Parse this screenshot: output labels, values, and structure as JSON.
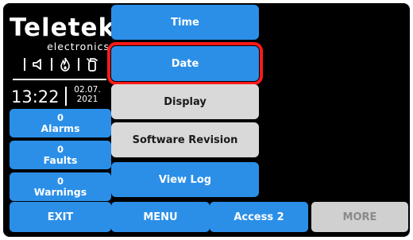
{
  "logo": {
    "brand": "Teletek",
    "sub": "electronics"
  },
  "status_icons": [
    "speaker-icon",
    "fire-icon",
    "extinguisher-icon"
  ],
  "clock": {
    "time": "13:22",
    "date_day_month": "02.07.",
    "date_year": "2021"
  },
  "status": [
    {
      "count": "0",
      "label": "Alarms"
    },
    {
      "count": "0",
      "label": "Faults"
    },
    {
      "count": "0",
      "label": "Warnings"
    }
  ],
  "menu": [
    {
      "label": "Time",
      "style": "blue",
      "selected": false
    },
    {
      "label": "Date",
      "style": "blue",
      "selected": true
    },
    {
      "label": "Display",
      "style": "gray",
      "selected": false
    },
    {
      "label": "Software Revision",
      "style": "gray",
      "selected": false
    },
    {
      "label": "View Log",
      "style": "blue",
      "selected": false
    }
  ],
  "bottom": {
    "exit": "EXIT",
    "menu": "MENU",
    "access": "Access 2",
    "more": "MORE"
  },
  "colors": {
    "accent": "#2b8fe8",
    "selection": "#ff1a1a",
    "disabled": "#d0d0d0"
  }
}
